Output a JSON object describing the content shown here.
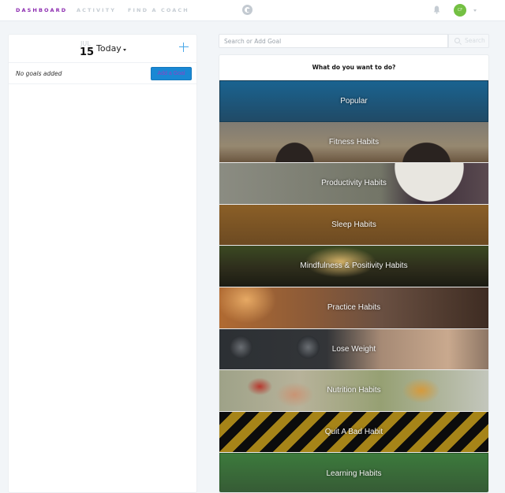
{
  "nav": {
    "links": [
      {
        "label": "DASHBOARD",
        "active": true
      },
      {
        "label": "ACTIVITY",
        "active": false
      },
      {
        "label": "FIND A COACH",
        "active": false
      }
    ],
    "logo_icon": "coach-logo-icon",
    "notifications_icon": "bell-icon",
    "avatar_initials": "CF",
    "avatar_color": "#74c043",
    "active_color": "#8c2bb0"
  },
  "left": {
    "month": "JUL",
    "day": "15",
    "date_label": "Today",
    "add_icon": "plus-icon",
    "empty_message": "No goals added",
    "add_goal_label": "Add a Goal"
  },
  "search": {
    "placeholder": "Search or Add Goal",
    "value": "",
    "button_label": "Search"
  },
  "categories": {
    "title": "What do you want to do?",
    "items": [
      {
        "label": "Popular"
      },
      {
        "label": "Fitness Habits"
      },
      {
        "label": "Productivity Habits"
      },
      {
        "label": "Sleep Habits"
      },
      {
        "label": "Mindfulness & Positivity Habits"
      },
      {
        "label": "Practice Habits"
      },
      {
        "label": "Lose Weight"
      },
      {
        "label": "Nutrition Habits"
      },
      {
        "label": "Quit A Bad Habit"
      },
      {
        "label": "Learning Habits"
      }
    ]
  }
}
